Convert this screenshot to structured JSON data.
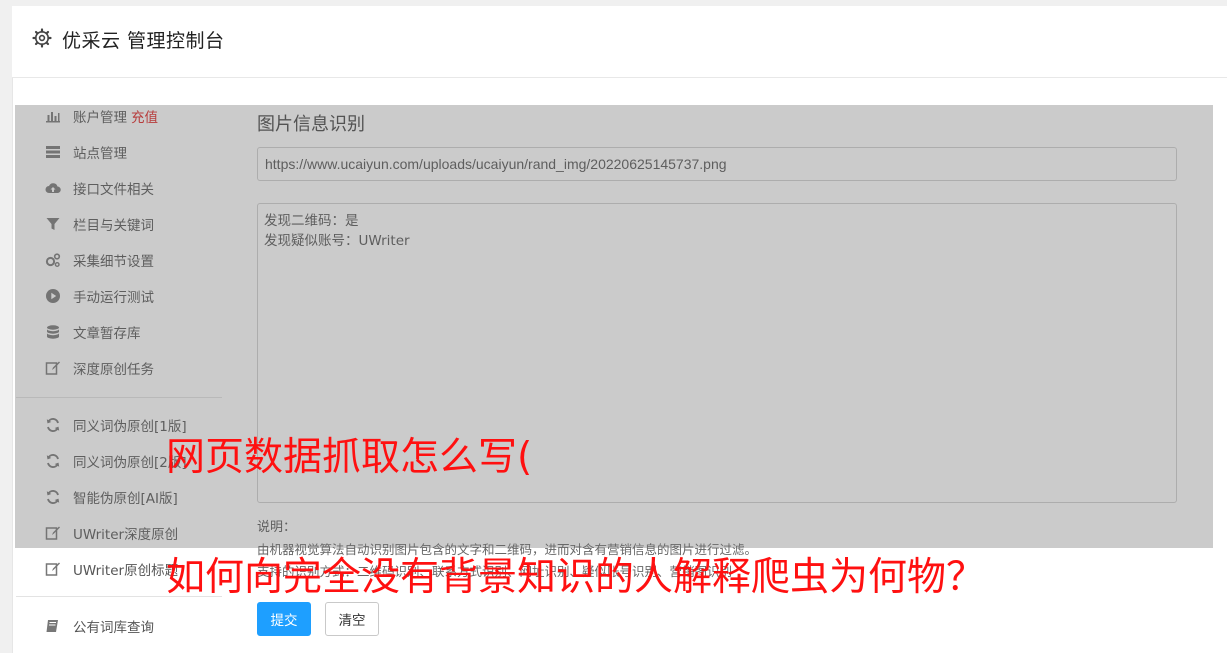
{
  "app": {
    "title": "优采云 管理控制台",
    "icon": "gear-icon"
  },
  "sidebar": {
    "group1": [
      {
        "label": "账户管理",
        "extra": "充值",
        "icon": "bar-chart-icon"
      },
      {
        "label": "站点管理",
        "icon": "server-icon"
      },
      {
        "label": "接口文件相关",
        "icon": "cloud-upload-icon"
      },
      {
        "label": "栏目与关键词",
        "icon": "filter-icon"
      },
      {
        "label": "采集细节设置",
        "icon": "cogs-icon"
      },
      {
        "label": "手动运行测试",
        "icon": "play-circle-icon"
      },
      {
        "label": "文章暂存库",
        "icon": "database-icon"
      },
      {
        "label": "深度原创任务",
        "icon": "edit-icon"
      }
    ],
    "group2": [
      {
        "label": "同义词伪原创[1版]",
        "icon": "refresh-icon"
      },
      {
        "label": "同义词伪原创[2版]",
        "icon": "refresh-icon"
      },
      {
        "label": "智能伪原创[AI版]",
        "icon": "refresh-icon"
      },
      {
        "label": "UWriter深度原创",
        "icon": "edit-icon"
      },
      {
        "label": "UWriter原创标题",
        "icon": "edit-icon"
      }
    ],
    "group3": [
      {
        "label": "公有词库查询",
        "icon": "book-icon"
      }
    ]
  },
  "main": {
    "title": "图片信息识别",
    "url_value": "https://www.ucaiyun.com/uploads/ucaiyun/rand_img/20220625145737.png",
    "result_lines": [
      "发现二维码：是",
      "发现疑似账号：UWriter"
    ],
    "desc_label": "说明：",
    "desc_line1": "由机器视觉算法自动识别图片包含的文字和二维码，进而对含有营销信息的图片进行过滤。",
    "desc_line2": "支持的识别方式：二维码识别、联系方式识别、网址识别、疑似账号识别、营销图识别",
    "submit_label": "提交",
    "clear_label": "清空"
  },
  "watermark": {
    "line1": "网页数据抓取怎么写(",
    "line2": "如何向完全没有背景知识的人解释爬虫为何物？"
  },
  "colors": {
    "primary": "#1e9fff",
    "watermark": "#ff1010",
    "recharge": "#e02020"
  }
}
